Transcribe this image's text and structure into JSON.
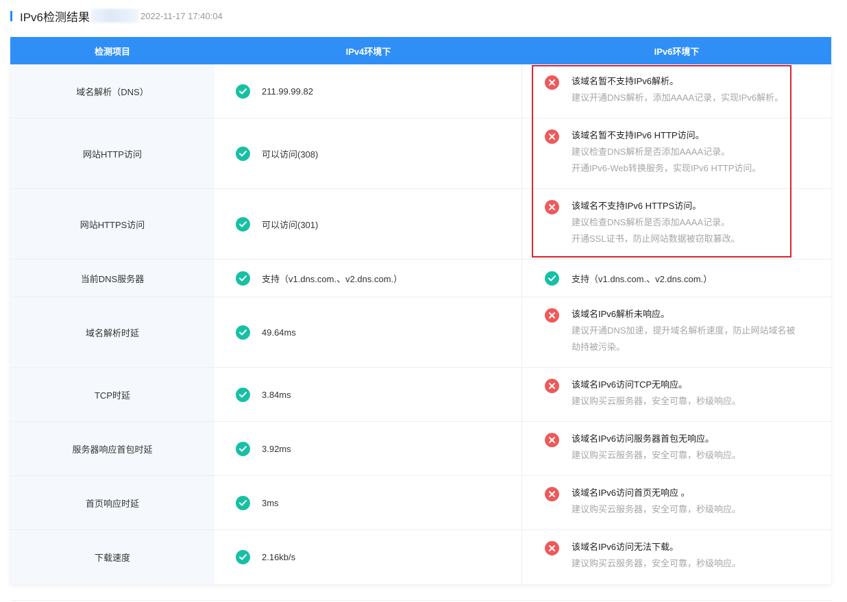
{
  "header": {
    "title": "IPv6检测结果",
    "timestamp": "2022-11-17 17:40:04"
  },
  "table": {
    "columns": [
      "检测项目",
      "IPv4环境下",
      "IPv6环境下"
    ],
    "rows": [
      {
        "item": "域名解析（DNS）",
        "ipv4": "211.99.99.82",
        "ipv6_status": "error",
        "ipv6_main": "该域名暂不支持IPv6解析。",
        "ipv6_sub": [
          "建议开通DNS解析，添加AAAA记录，实现IPv6解析。"
        ]
      },
      {
        "item": "网站HTTP访问",
        "ipv4": "可以访问(308)",
        "ipv6_status": "error",
        "ipv6_main": "该域名暂不支持IPv6 HTTP访问。",
        "ipv6_sub": [
          "建议检查DNS解析是否添加AAAA记录。",
          "开通IPv6-Web转换服务，实现IPv6 HTTP访问。"
        ]
      },
      {
        "item": "网站HTTPS访问",
        "ipv4": "可以访问(301)",
        "ipv6_status": "error",
        "ipv6_main": "该域名不支持IPv6 HTTPS访问。",
        "ipv6_sub": [
          "建议检查DNS解析是否添加AAAA记录。",
          "开通SSL证书，防止网站数据被窃取篡改。"
        ]
      },
      {
        "item": "当前DNS服务器",
        "ipv4": "支持（v1.dns.com.、v2.dns.com.）",
        "ipv6_status": "ok",
        "ipv6_main": "支持（v1.dns.com.、v2.dns.com.）",
        "ipv6_sub": []
      },
      {
        "item": "域名解析时延",
        "ipv4": "49.64ms",
        "ipv6_status": "error",
        "ipv6_main": "该域名IPv6解析未响应。",
        "ipv6_sub": [
          "建议开通DNS加速，提升域名解析速度，防止网站域名被",
          "劫持被污染。"
        ]
      },
      {
        "item": "TCP时延",
        "ipv4": "3.84ms",
        "ipv6_status": "error",
        "ipv6_main": "该域名IPv6访问TCP无响应。",
        "ipv6_sub": [
          "建议购买云服务器，安全可靠，秒级响应。"
        ]
      },
      {
        "item": "服务器响应首包时延",
        "ipv4": "3.92ms",
        "ipv6_status": "error",
        "ipv6_main": "该域名IPv6访问服务器首包无响应。",
        "ipv6_sub": [
          "建议购买云服务器，安全可靠，秒级响应。"
        ]
      },
      {
        "item": "首页响应时延",
        "ipv4": "3ms",
        "ipv6_status": "error",
        "ipv6_main": "该域名IPv6访问首页无响应 。",
        "ipv6_sub": [
          "建议购买云服务器，安全可靠，秒级响应。"
        ]
      },
      {
        "item": "下载速度",
        "ipv4": "2.16kb/s",
        "ipv6_status": "error",
        "ipv6_main": "该域名IPv6访问无法下载。",
        "ipv6_sub": [
          "建议购买云服务器，安全可靠，秒级响应。"
        ]
      }
    ]
  },
  "icons": {
    "ok": "check-circle-icon",
    "error": "close-circle-icon"
  },
  "colors": {
    "header_bg": "#2f8ff7",
    "ok": "#16c0a5",
    "error": "#f0585a",
    "highlight": "#d9232d",
    "accent": "#1a8cff"
  }
}
